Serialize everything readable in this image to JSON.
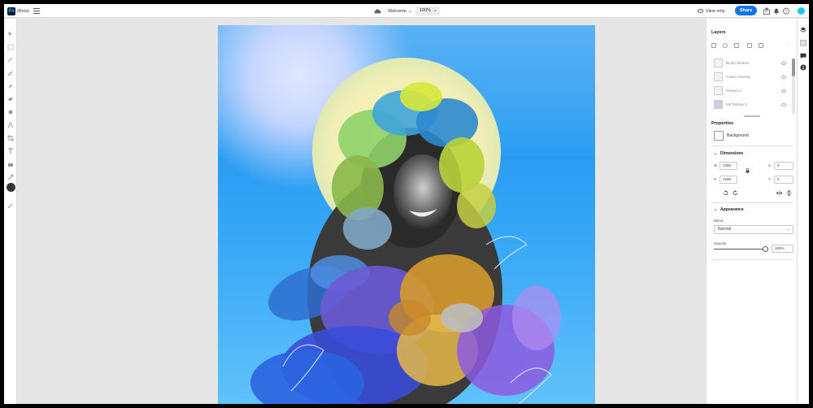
{
  "app": {
    "logo": "Ps",
    "beta": "(Beta)"
  },
  "topbar": {
    "doc_title": "Welcome",
    "zoom": "100%",
    "view_only": "View only",
    "share": "Share"
  },
  "layers": {
    "title": "Layers",
    "items": [
      {
        "name": "Brush Strokes"
      },
      {
        "name": "Colour Overlay"
      },
      {
        "name": "Flowers 2"
      },
      {
        "name": "Ink Texture 2"
      }
    ]
  },
  "properties": {
    "title": "Properties",
    "layer_name": "Background",
    "dimensions": {
      "title": "Dimensions",
      "w_label": "W",
      "w": "1300",
      "h_label": "H",
      "h": "1200",
      "x_label": "X",
      "x": "0",
      "y_label": "Y",
      "y": "0"
    },
    "appearance": {
      "title": "Appearance",
      "blend_label": "Blend",
      "blend_value": "Normal",
      "opacity_label": "Opacity",
      "opacity_value": "100%",
      "opacity": 1.0
    }
  },
  "colors": {
    "accent": "#1473e6",
    "avatar": "#1ec9f0"
  }
}
